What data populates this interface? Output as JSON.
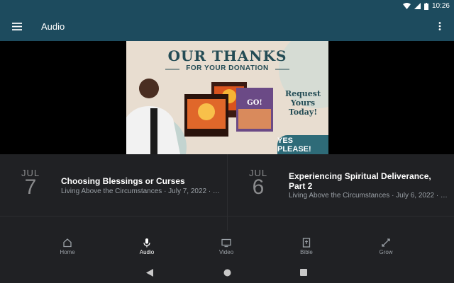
{
  "status": {
    "time": "10:26"
  },
  "appbar": {
    "title": "Audio"
  },
  "banner": {
    "heading": "OUR THANKS",
    "subheading": "FOR YOUR DONATION",
    "request_line1": "Request",
    "request_line2": "Yours",
    "request_line3": "Today!",
    "cta": "YES PLEASE!",
    "product_text": "GO!"
  },
  "episodes": [
    {
      "month": "JUL",
      "day": "7",
      "title": "Choosing Blessings or Curses",
      "subtitle": "Living Above the Circumstances · July 7, 2022 · To..."
    },
    {
      "month": "JUL",
      "day": "6",
      "title": "Experiencing Spiritual Deliverance, Part 2",
      "subtitle": "Living Above the Circumstances · July 6, 2022 · To..."
    }
  ],
  "nav": {
    "items": [
      {
        "label": "Home",
        "icon": "home-icon"
      },
      {
        "label": "Audio",
        "icon": "microphone-icon"
      },
      {
        "label": "Video",
        "icon": "tv-icon"
      },
      {
        "label": "Bible",
        "icon": "bible-icon"
      },
      {
        "label": "Grow",
        "icon": "grow-icon"
      }
    ],
    "active": "Audio"
  },
  "colors": {
    "appbar": "#1d4b5e",
    "surface": "#202124",
    "banner_teal": "#244c55"
  }
}
